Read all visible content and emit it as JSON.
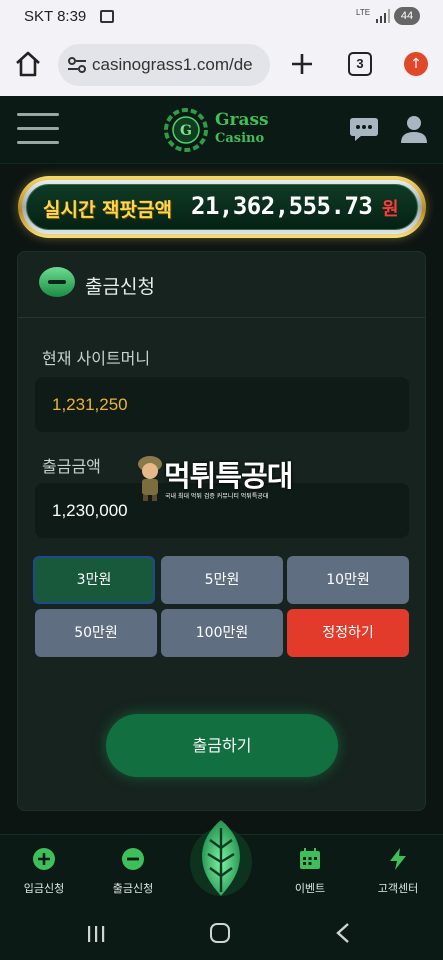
{
  "status_bar": {
    "carrier_time": "SKT 8:39",
    "network": "LTE",
    "battery": "44"
  },
  "browser": {
    "url": "casinograss1.com/de",
    "tab_count": "3"
  },
  "brand": {
    "line1": "Grass",
    "line2": "Casino",
    "emblem_letter": "G"
  },
  "jackpot": {
    "label": "실시간 잭팟금액",
    "amount": "21,362,555.73",
    "currency": "원"
  },
  "withdraw": {
    "title": "출금신청",
    "balance_label": "현재 사이트머니",
    "balance_value": "1,231,250",
    "amount_label": "출금금액",
    "amount_value": "1,230,000",
    "quick_amounts": [
      {
        "label": "3만원",
        "active": true
      },
      {
        "label": "5만원",
        "active": false
      },
      {
        "label": "10만원",
        "active": false
      },
      {
        "label": "50만원",
        "active": false
      },
      {
        "label": "100만원",
        "active": false
      }
    ],
    "reset_label": "정정하기",
    "submit_label": "출금하기"
  },
  "watermark": {
    "title": "먹튀특공대",
    "subtitle": "국내 최대 먹튀 검증 커뮤니티 먹튀특공대"
  },
  "bottom_nav": {
    "items": [
      {
        "label": "입금신청",
        "icon": "plus-circle-icon"
      },
      {
        "label": "출금신청",
        "icon": "minus-circle-icon"
      },
      {
        "label": "이벤트",
        "icon": "calendar-icon"
      },
      {
        "label": "고객센터",
        "icon": "lightning-icon"
      }
    ]
  },
  "colors": {
    "accent_green": "#127040",
    "gold_text": "#e8b43a",
    "reset_red": "#e23b2c",
    "button_gray": "#5f6f81"
  }
}
